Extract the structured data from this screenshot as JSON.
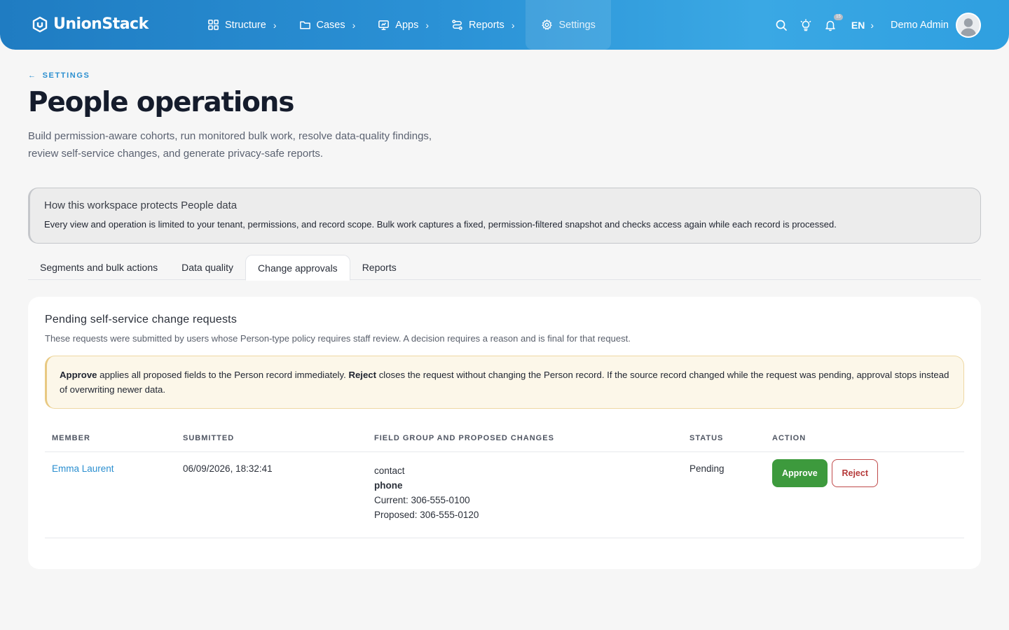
{
  "brand": {
    "name": "UnionStack"
  },
  "nav": [
    {
      "label": "Structure",
      "icon": "grid-icon"
    },
    {
      "label": "Cases",
      "icon": "folder-icon"
    },
    {
      "label": "Apps",
      "icon": "monitor-icon"
    },
    {
      "label": "Reports",
      "icon": "route-icon"
    },
    {
      "label": "Settings",
      "icon": "gear-icon"
    }
  ],
  "header": {
    "notification_count": "15",
    "language": "EN",
    "user_name": "Demo Admin"
  },
  "page": {
    "back_label": "SETTINGS",
    "title": "People operations",
    "subtitle": "Build permission-aware cohorts, run monitored bulk work, resolve data-quality findings, review self-service changes, and generate privacy-safe reports."
  },
  "info": {
    "heading": "How this workspace protects People data",
    "body": "Every view and operation is limited to your tenant, permissions, and record scope. Bulk work captures a fixed, permission-filtered snapshot and checks access again while each record is processed."
  },
  "tabs": [
    "Segments and bulk actions",
    "Data quality",
    "Change approvals",
    "Reports"
  ],
  "active_tab": "Change approvals",
  "card": {
    "title": "Pending self-service change requests",
    "description": "These requests were submitted by users whose Person-type policy requires staff review. A decision requires a reason and is final for that request.",
    "notice": {
      "approve_word": "Approve",
      "approve_text": " applies all proposed fields to the Person record immediately. ",
      "reject_word": "Reject",
      "reject_text": " closes the request without changing the Person record. If the source record changed while the request was pending, approval stops instead of overwriting newer data."
    },
    "columns": [
      "MEMBER",
      "SUBMITTED",
      "FIELD GROUP AND PROPOSED CHANGES",
      "STATUS",
      "ACTION"
    ],
    "rows": [
      {
        "member": "Emma Laurent",
        "submitted": "06/09/2026, 18:32:41",
        "field_group": "contact",
        "field_name": "phone",
        "current": "Current: 306-555-0100",
        "proposed": "Proposed: 306-555-0120",
        "status": "Pending",
        "approve_label": "Approve",
        "reject_label": "Reject"
      }
    ]
  },
  "colors": {
    "header_gradient_start": "#1f7cc2",
    "header_gradient_end": "#3aa8e4",
    "link": "#2b8fd0",
    "approve": "#3d9a3d",
    "reject": "#b53a3a",
    "notice_bg": "#fcf7e9"
  }
}
